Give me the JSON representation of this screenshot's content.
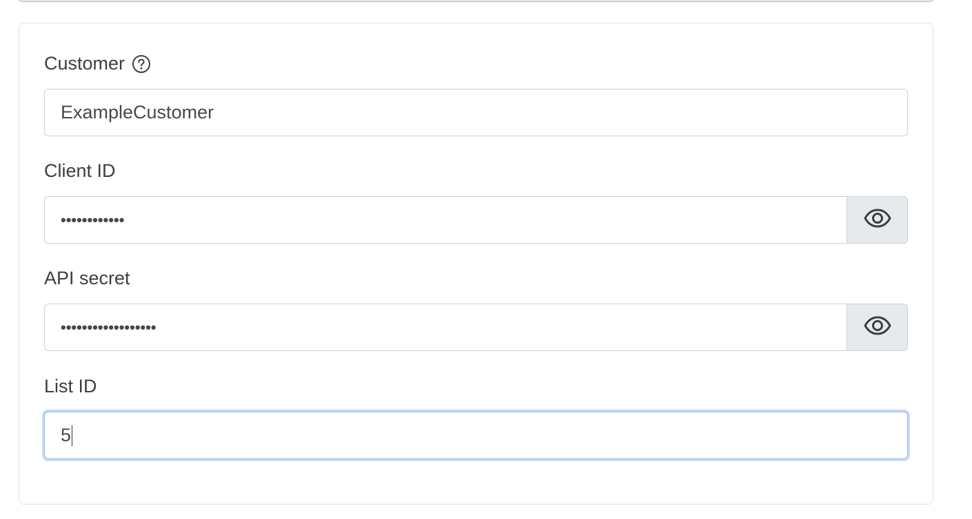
{
  "form": {
    "customer": {
      "label": "Customer",
      "help_icon": "question-circle-icon",
      "value": "ExampleCustomer"
    },
    "client_id": {
      "label": "Client ID",
      "masked_value": "••••••••••••",
      "toggle_icon": "eye-icon"
    },
    "api_secret": {
      "label": "API secret",
      "masked_value": "••••••••••••••••••",
      "toggle_icon": "eye-icon"
    },
    "list_id": {
      "label": "List ID",
      "value": "5",
      "focused": true
    }
  },
  "colors": {
    "focus_border": "#8db8ee",
    "focus_glow": "#c4dcf8",
    "addon_background": "#e7eaed",
    "text": "#3b3e43"
  }
}
